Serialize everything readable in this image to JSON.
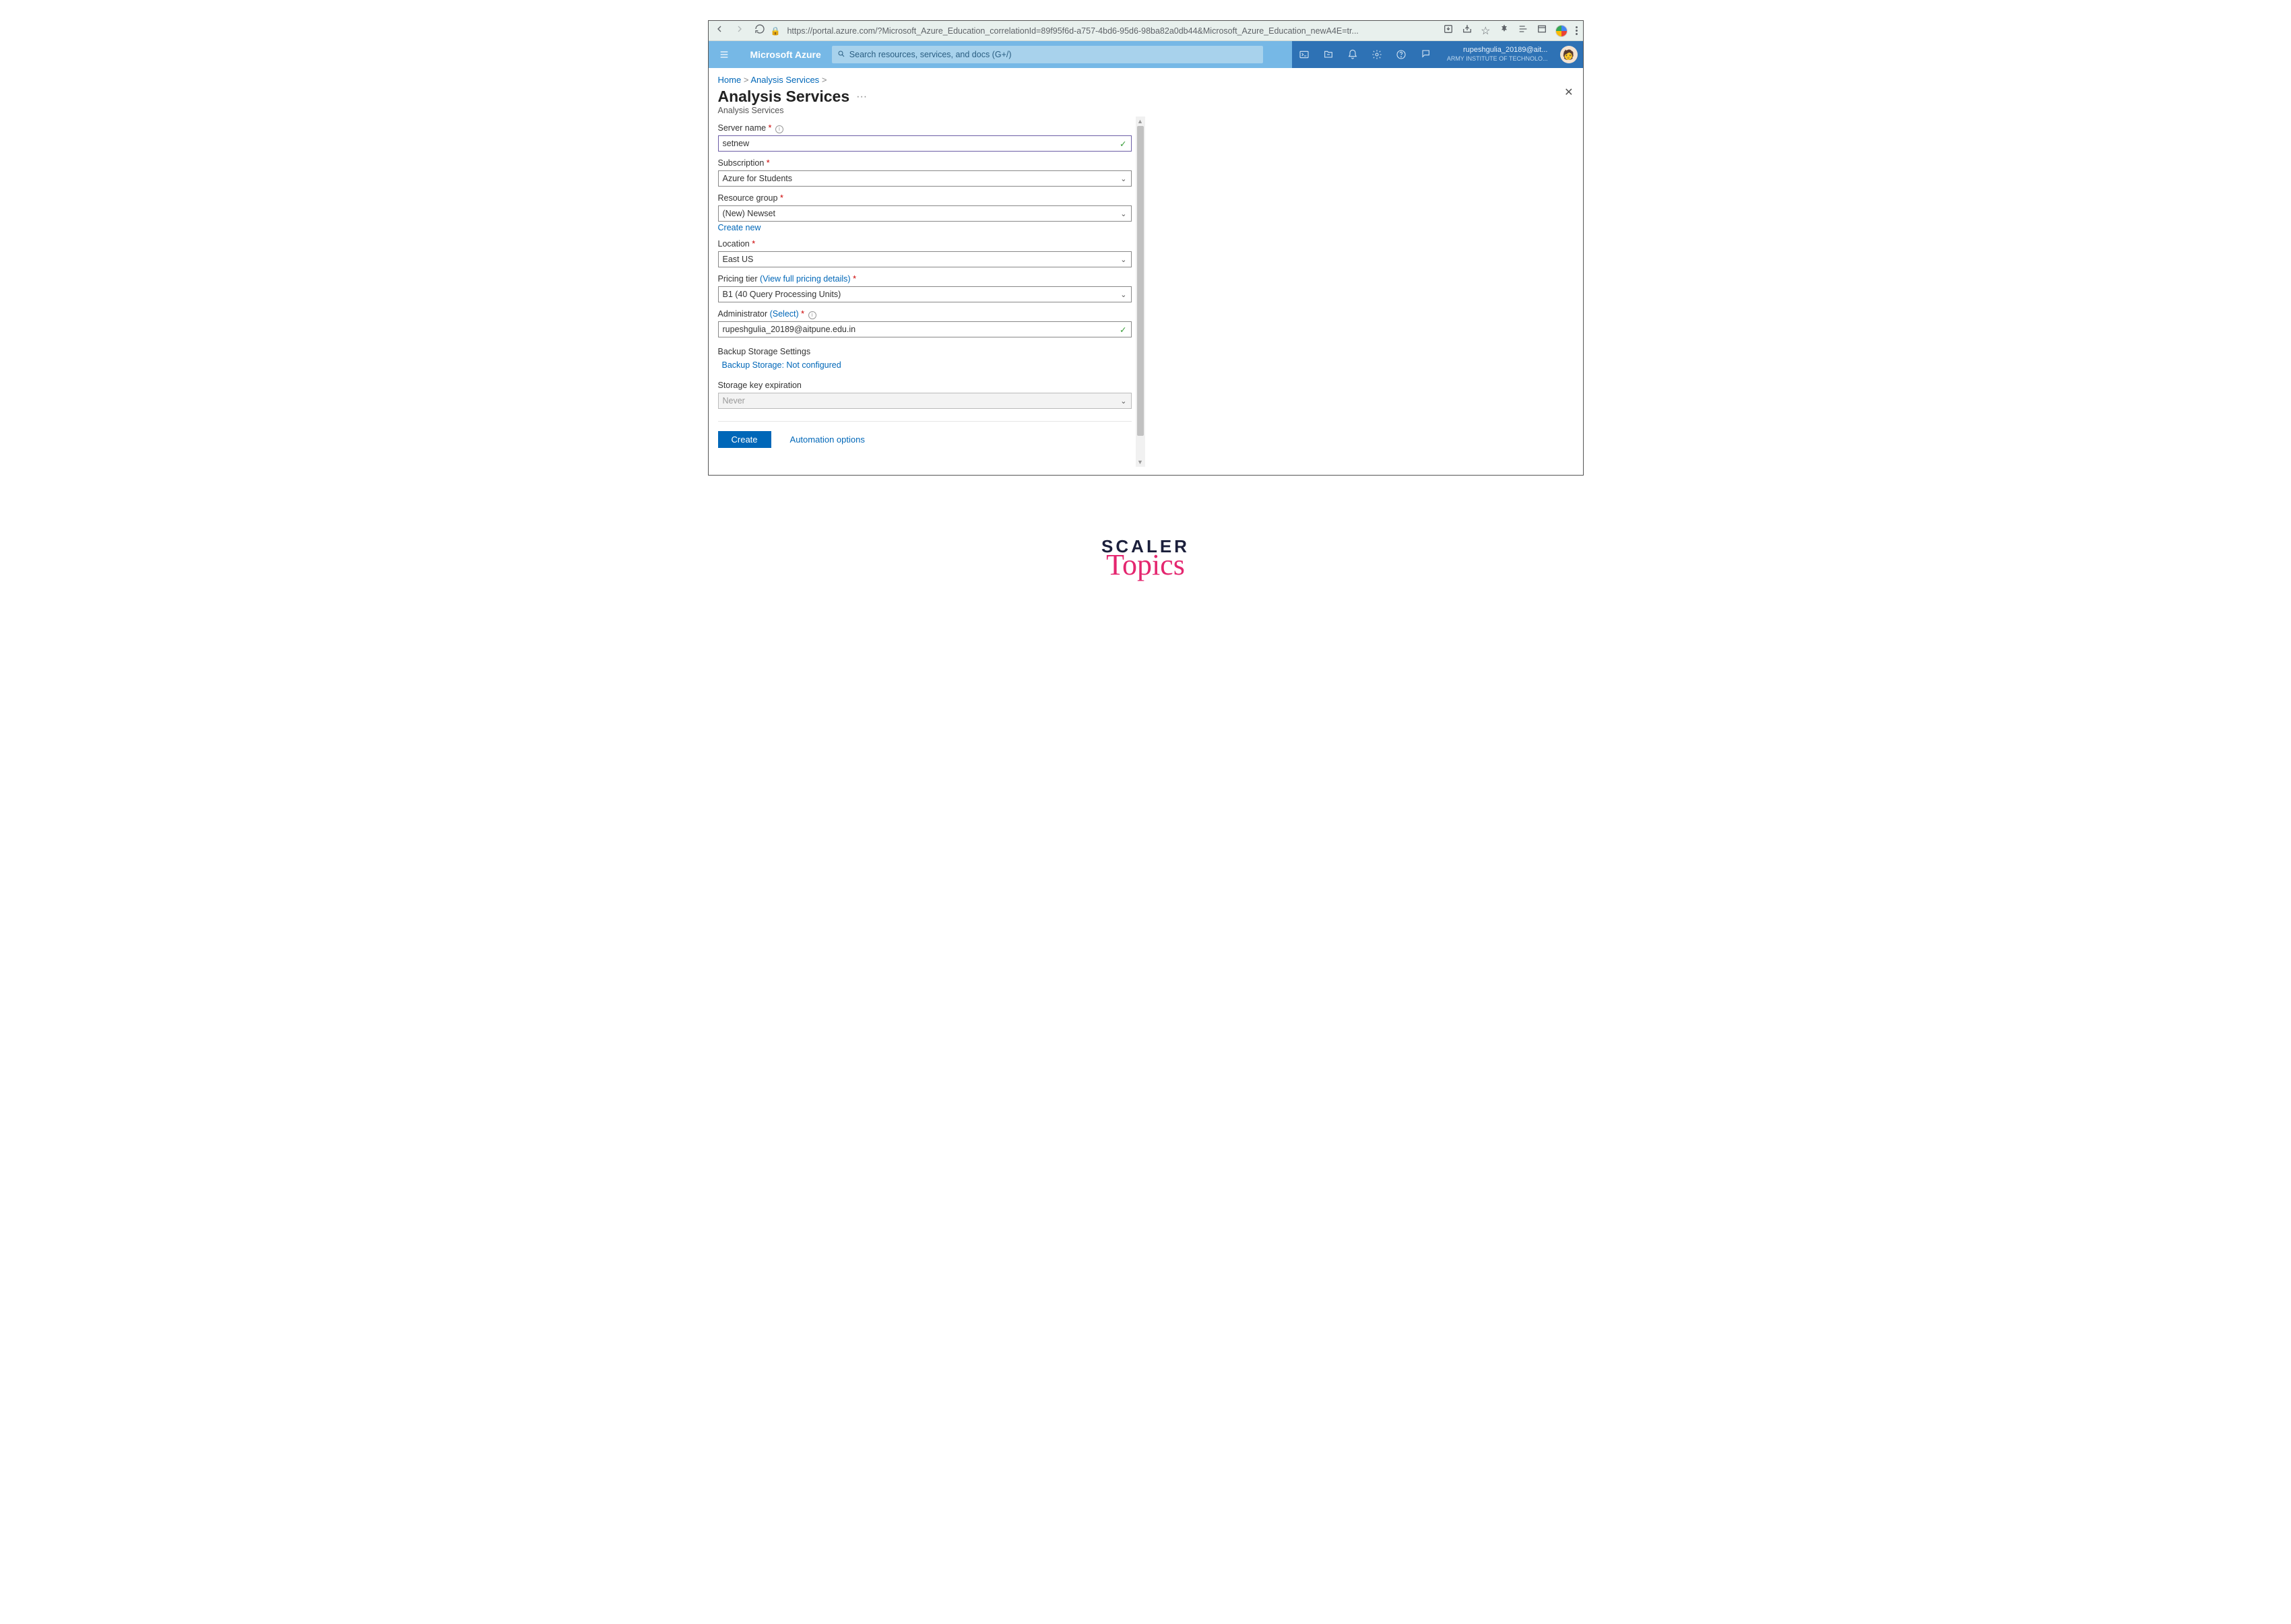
{
  "browser": {
    "url": "https://portal.azure.com/?Microsoft_Azure_Education_correlationId=89f95f6d-a757-4bd6-95d6-98ba82a0db44&Microsoft_Azure_Education_newA4E=tr..."
  },
  "azure": {
    "brand": "Microsoft Azure",
    "search_placeholder": "Search resources, services, and docs (G+/)",
    "user": {
      "email_trunc": "rupeshgulia_20189@ait...",
      "tenant_trunc": "ARMY INSTITUTE OF TECHNOLO..."
    }
  },
  "breadcrumb": {
    "home": "Home",
    "svc": "Analysis Services"
  },
  "page": {
    "title": "Analysis Services",
    "subtitle": "Analysis Services",
    "more": "···"
  },
  "form": {
    "server_name": {
      "label": "Server name",
      "value": "setnew"
    },
    "subscription": {
      "label": "Subscription",
      "value": "Azure for Students"
    },
    "resource_group": {
      "label": "Resource group",
      "value": "(New) Newset",
      "create_new": "Create new"
    },
    "location": {
      "label": "Location",
      "value": "East US"
    },
    "pricing": {
      "label_pre": "Pricing tier ",
      "link": "(View full pricing details)",
      "value": "B1 (40 Query Processing Units)"
    },
    "admin": {
      "label_pre": "Administrator ",
      "link": "(Select)",
      "value": "rupeshgulia_20189@aitpune.edu.in"
    },
    "backup": {
      "heading": "Backup Storage Settings",
      "status": "Backup Storage: Not configured"
    },
    "key_exp": {
      "label": "Storage key expiration",
      "value": "Never"
    }
  },
  "footer": {
    "create": "Create",
    "automation": "Automation options"
  },
  "badge": {
    "scaler": "SCALER",
    "topics": "Topics"
  }
}
